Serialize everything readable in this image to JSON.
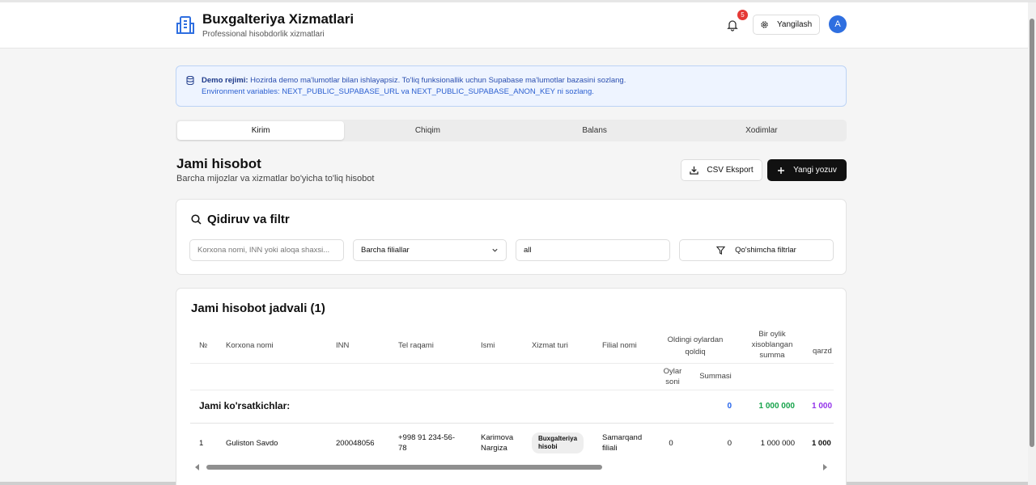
{
  "header": {
    "title": "Buxgalteriya Xizmatlari",
    "subtitle": "Professional hisobdorlik xizmatlari",
    "notification_count": "5",
    "refresh_label": "Yangilash",
    "avatar_initial": "A"
  },
  "demo": {
    "label": "Demo rejimi:",
    "line1": " Hozirda demo ma'lumotlar bilan ishlayapsiz. To'liq funksionallik uchun Supabase ma'lumotlar bazasini sozlang.",
    "line2": "Environment variables: NEXT_PUBLIC_SUPABASE_URL va NEXT_PUBLIC_SUPABASE_ANON_KEY ni sozlang."
  },
  "tabs": [
    {
      "label": "Kirim",
      "active": true
    },
    {
      "label": "Chiqim",
      "active": false
    },
    {
      "label": "Balans",
      "active": false
    },
    {
      "label": "Xodimlar",
      "active": false
    }
  ],
  "section": {
    "title": "Jami hisobot",
    "subtitle": "Barcha mijozlar va xizmatlar bo'yicha to'liq hisobot",
    "csv_label": "CSV Eksport",
    "new_label": "Yangi yozuv"
  },
  "filters": {
    "title": "Qidiruv va filtr",
    "search_placeholder": "Korxona nomi, INN yoki aloqa shaxsi...",
    "branch_value": "Barcha filiallar",
    "status_value": "all",
    "more_label": "Qo'shimcha filtrlar"
  },
  "table": {
    "title": "Jami hisobot jadvali (1)",
    "columns": {
      "num": "№",
      "company": "Korxona nomi",
      "inn": "INN",
      "phone": "Tel raqami",
      "name": "Ismi",
      "service": "Xizmat turi",
      "branch": "Filial nomi",
      "prev_line1": "Oldingi oylardan",
      "prev_line2": "qoldiq",
      "monthly_line1": "Bir oylik",
      "monthly_line2": "xisoblangan",
      "monthly_line3": "summa",
      "debt": "qarzd",
      "months_line1": "Oylar",
      "months_line2": "soni",
      "sum": "Summasi"
    },
    "totals": {
      "label": "Jami ko'rsatkichlar:",
      "prev_sum": "0",
      "monthly": "1 000 000",
      "debt": "1 000"
    },
    "rows": [
      {
        "num": "1",
        "company": "Guliston Savdo",
        "inn": "200048056",
        "phone_line1": "+998 91 234-56-",
        "phone_line2": "78",
        "name_line1": "Karimova",
        "name_line2": "Nargiza",
        "service_line1": "Buxgalteriya",
        "service_line2": "hisobi",
        "branch_line1": "Samarqand",
        "branch_line2": "filiali",
        "months": "0",
        "sum": "0",
        "monthly": "1 000 000",
        "debt": "1 000"
      }
    ]
  },
  "colors": {
    "accent_blue": "#2f6fe0",
    "total_blue": "#2563eb",
    "total_green": "#16a34a",
    "total_purple": "#9333ea",
    "badge_red": "#e53935"
  }
}
